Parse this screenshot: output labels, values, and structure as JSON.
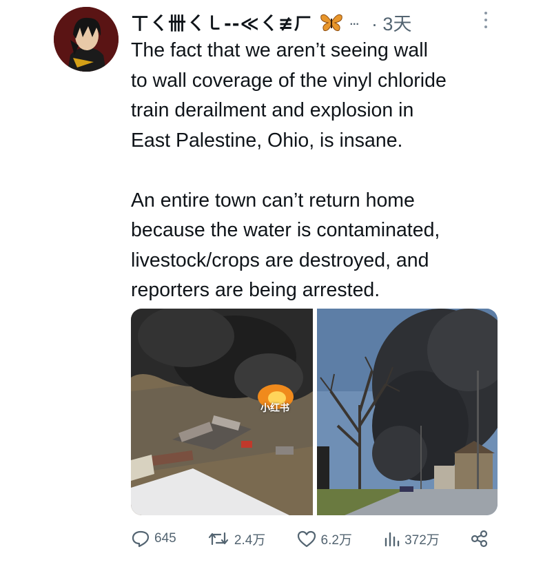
{
  "tweet": {
    "display_name": "ㄒㄑ卌ㄑ㇄--≪ㄑ≢ㄏ",
    "ellipsis": "...",
    "timestamp": "· 3天",
    "paragraphs": [
      [
        "The fact that we aren’t seeing wall",
        "to wall coverage of the vinyl chloride",
        "train derailment and explosion in",
        "East Palestine, Ohio, is insane."
      ],
      [
        "An entire town can’t return home",
        "because the water is contaminated,",
        "livestock/crops are destroyed, and",
        "reporters are being arrested."
      ]
    ],
    "media_watermark": "小红书",
    "actions": {
      "replies": "645",
      "retweets": "2.4万",
      "likes": "6.2万",
      "views": "372万"
    }
  },
  "colors": {
    "text": "#0f1419",
    "muted": "#536471",
    "avatar_bg": "#5a1414",
    "badge": "#e8962b"
  },
  "icons": [
    "butterfly-badge-icon",
    "more-options-icon",
    "reply-icon",
    "retweet-icon",
    "like-icon",
    "views-icon",
    "share-icon"
  ]
}
